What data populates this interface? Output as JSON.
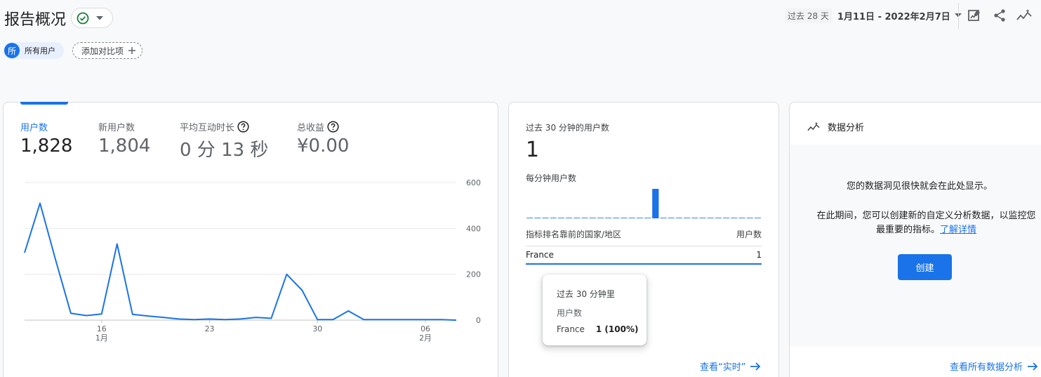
{
  "header": {
    "title": "报告概况",
    "date_prefix": "过去 28 天",
    "date_range": "1月11日 - 2022年2月7日",
    "icons": [
      "check-circle-icon",
      "caret-down-icon",
      "edit-report-icon",
      "share-icon",
      "insights-icon"
    ]
  },
  "comparison": {
    "avatar_letter": "所",
    "segment": "所有用户",
    "add_label": "添加对比项"
  },
  "metrics": [
    {
      "label": "用户数",
      "value": "1,828"
    },
    {
      "label": "新用户数",
      "value": "1,804"
    },
    {
      "label": "平均互动时长",
      "value": "0 分 13 秒"
    },
    {
      "label": "总收益",
      "value": "¥0.00"
    }
  ],
  "chart_data": {
    "type": "line",
    "series": [
      {
        "values": [
          294,
          510,
          266,
          30,
          20,
          27,
          332,
          25,
          18,
          12,
          5,
          2,
          5,
          2,
          5,
          12,
          8,
          200,
          130,
          2,
          2,
          40,
          2,
          2,
          2,
          2,
          2,
          2,
          0
        ]
      }
    ],
    "y_ticks": [
      "0",
      "200",
      "400",
      "600"
    ],
    "ylim": [
      0,
      600
    ],
    "x_ticks": [
      {
        "label": "16",
        "sub": "1月",
        "index": 5
      },
      {
        "label": "23",
        "sub": "",
        "index": 12
      },
      {
        "label": "30",
        "sub": "",
        "index": 19
      },
      {
        "label": "06",
        "sub": "2月",
        "index": 26
      }
    ],
    "grid": true,
    "color": "#1a73e8"
  },
  "realtime": {
    "title": "过去 30 分钟的用户数",
    "value": "1",
    "per_minute_label": "每分钟用户数",
    "per_minute_values": [
      0,
      0,
      0,
      0,
      0,
      0,
      0,
      0,
      0,
      0,
      0,
      0,
      0,
      0,
      0,
      0,
      1,
      0,
      0,
      0,
      0,
      0,
      0,
      0,
      0,
      0,
      0,
      0,
      0,
      0
    ],
    "table_head": {
      "country": "指标排名靠前的国家/地区",
      "users": "用户数"
    },
    "rows": [
      {
        "country": "France",
        "users": "1"
      }
    ],
    "tooltip": {
      "title": "过去 30 分钟里",
      "metric": "用户数",
      "country": "France",
      "value": "1 (100%)"
    },
    "link": "查看“实时”"
  },
  "insights": {
    "title": "数据分析",
    "message1": "您的数据洞见很快就会在此处显示。",
    "message2_line1": "在此期间，您可以创建新的自定义分析数据，以监控您",
    "message2_line2": "最重要的指标。",
    "learn_more": "了解详情",
    "create_button": "创建",
    "link": "查看所有数据分析"
  }
}
